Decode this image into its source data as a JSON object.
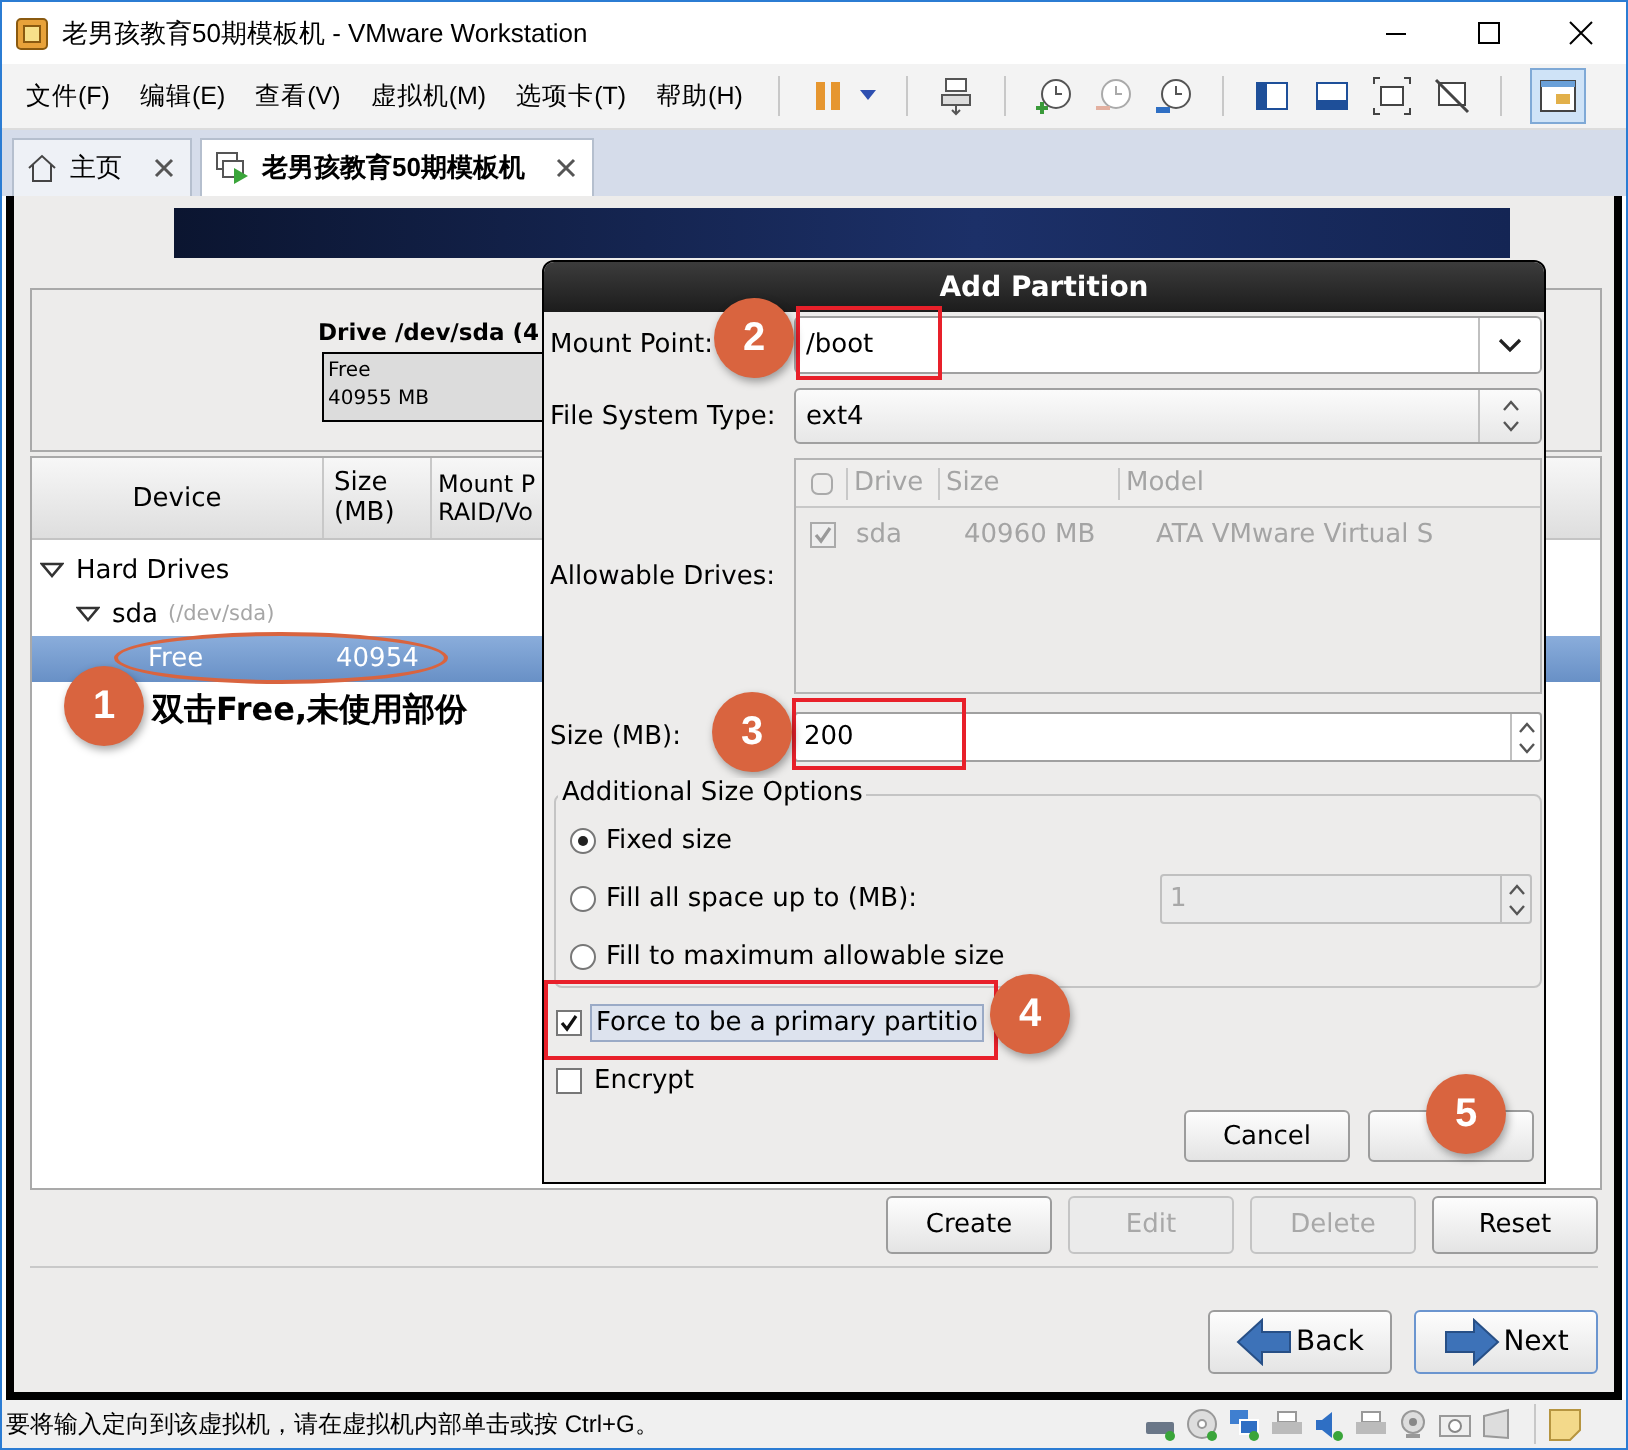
{
  "window": {
    "title": "老男孩教育50期模板机 - VMware Workstation"
  },
  "menu": [
    "文件(F)",
    "编辑(E)",
    "查看(V)",
    "虚拟机(M)",
    "选项卡(T)",
    "帮助(H)"
  ],
  "tabs": [
    {
      "label": "主页",
      "selected": false
    },
    {
      "label": "老男孩教育50期模板机",
      "selected": true
    }
  ],
  "installer": {
    "drive": {
      "title": "Drive /dev/sda (4",
      "segment": {
        "name": "Free",
        "size": "40955 MB"
      }
    },
    "table": {
      "columns": [
        "Device",
        "Size\n(MB)",
        "Mount P\nRAID/Vo"
      ],
      "rows": [
        {
          "label": "Hard Drives",
          "selected": false,
          "expanded": true,
          "children": [
            {
              "label": "sda",
              "detail": "(/dev/sda)",
              "selected": false,
              "expanded": true,
              "children": [
                {
                  "label": "Free",
                  "size": "40954",
                  "selected": true
                }
              ]
            }
          ]
        }
      ]
    },
    "buttons": [
      {
        "label": "Create",
        "disabled": false
      },
      {
        "label": "Edit",
        "disabled": true
      },
      {
        "label": "Delete",
        "disabled": true
      },
      {
        "label": "Reset",
        "disabled": false
      }
    ],
    "nav": [
      {
        "kind": "back",
        "label": "Back",
        "focused": false
      },
      {
        "kind": "next",
        "label": "Next",
        "focused": true
      }
    ]
  },
  "dialog": {
    "title": "Add Partition",
    "mount_point": {
      "label": "Mount Point:",
      "value": "/boot"
    },
    "file_system_type": {
      "label": "File System Type:",
      "value": "ext4"
    },
    "allowable_drives": {
      "label": "Allowable Drives:",
      "disabled": true,
      "columns": [
        "Drive",
        "Size",
        "Model"
      ],
      "rows": [
        {
          "checked": true,
          "drive": "sda",
          "size": "40960 MB",
          "model": "ATA VMware Virtual S"
        }
      ]
    },
    "size": {
      "label": "Size (MB):",
      "value": "200"
    },
    "size_options": {
      "title": "Additional Size Options",
      "options": [
        {
          "label": "Fixed size",
          "selected": true
        },
        {
          "label": "Fill all space up to (MB):",
          "selected": false,
          "spinner": {
            "value": "1",
            "disabled": true
          }
        },
        {
          "label": "Fill to maximum allowable size",
          "selected": false
        }
      ]
    },
    "checkboxes": [
      {
        "label": "Force to be a primary partitio",
        "checked": true,
        "focused": true
      },
      {
        "label": "Encrypt",
        "checked": false,
        "focused": false
      }
    ],
    "buttons": [
      {
        "kind": "text",
        "label": "Cancel"
      },
      {
        "kind": "blank"
      }
    ]
  },
  "annotations": [
    {
      "number": "1",
      "note": "双击Free,未使用部份"
    },
    {
      "number": "2"
    },
    {
      "number": "3"
    },
    {
      "number": "4"
    },
    {
      "number": "5"
    }
  ],
  "status_bar": {
    "text": "要将输入定向到该虚拟机，请在虚拟机内部单击或按 Ctrl+G。"
  }
}
